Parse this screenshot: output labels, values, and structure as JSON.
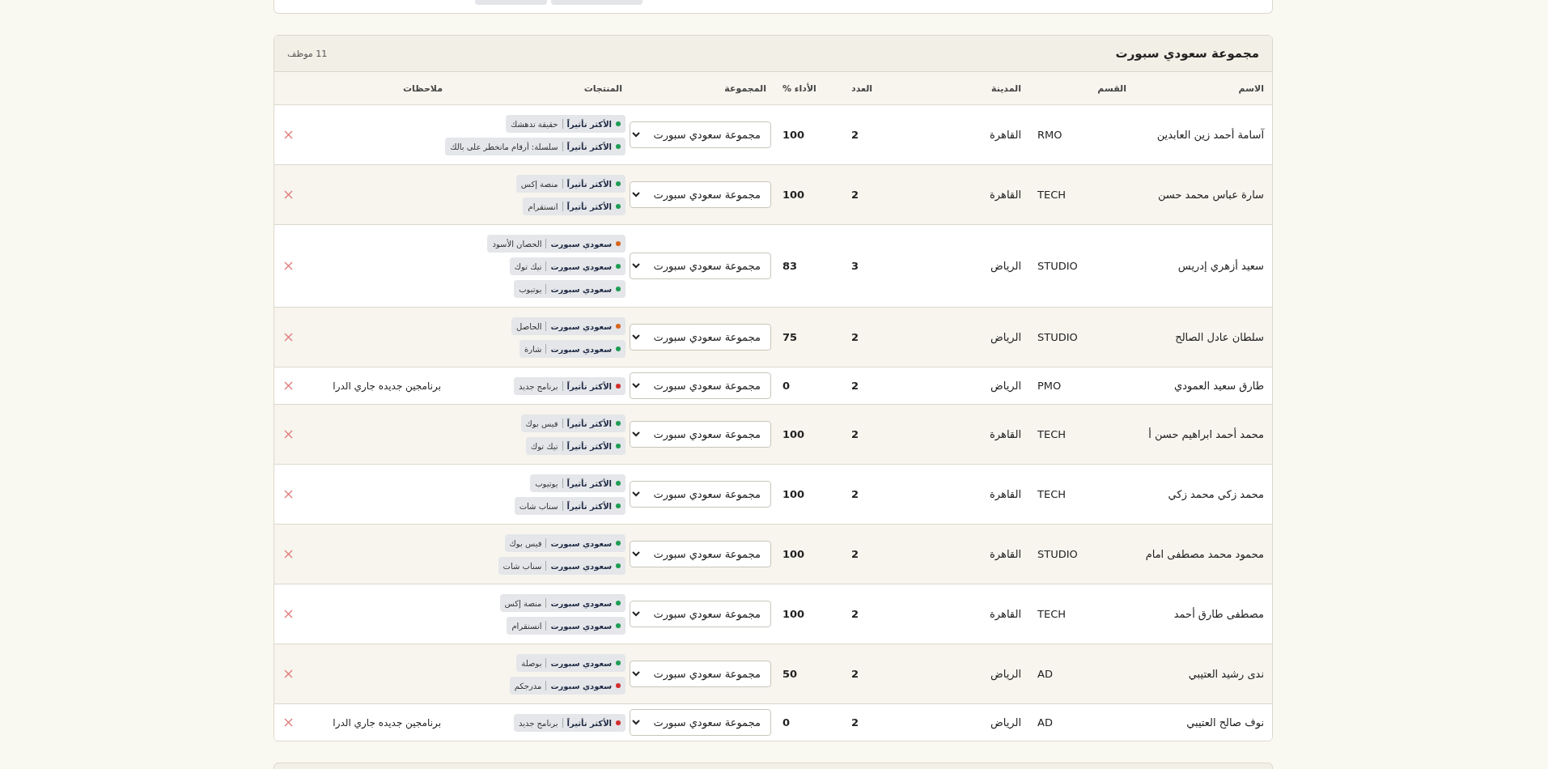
{
  "group": {
    "title": "مجموعة سعودي سبورت",
    "count": "11 موظف",
    "columns": [
      "الاسم",
      "القسم",
      "المدينة",
      "العدد",
      "الأداء %",
      "المجموعة",
      "المنتجات",
      "ملاحظات"
    ],
    "rows": [
      {
        "name": "آسامة أحمد زين العابدين",
        "department": "RMO",
        "city": "القاهرة",
        "count": "2",
        "performance": "100",
        "group": "مجموعة سعودي سبورت",
        "products": [
          {
            "label": "الأكثر تأثيراً",
            "name": "حقيقة تدهشك",
            "color": "#1f9d55"
          },
          {
            "label": "الأكثر تأثيراً",
            "name": "سلسلة: أرقام ماتخطر على بالك",
            "color": "#1f9d55"
          }
        ]
      },
      {
        "name": "سارة عباس محمد حسن",
        "department": "TECH",
        "city": "القاهرة",
        "count": "2",
        "performance": "100",
        "group": "مجموعة سعودي سبورت",
        "products": [
          {
            "label": "الأكثر تأثيراً",
            "name": "منصة إكس",
            "color": "#1f9d55"
          },
          {
            "label": "الأكثر تأثيراً",
            "name": "انستقرام",
            "color": "#1f9d55"
          }
        ]
      },
      {
        "name": "سعيد أزهري إدريس",
        "department": "STUDIO",
        "city": "الرياض",
        "count": "3",
        "performance": "83",
        "group": "مجموعة سعودي سبورت",
        "products": [
          {
            "label": "سعودي سبورت",
            "name": "الحصان الأسود",
            "color": "#d9661f"
          },
          {
            "label": "سعودي سبورت",
            "name": "تيك توك",
            "color": "#1f9d55"
          },
          {
            "label": "سعودي سبورت",
            "name": "يوتيوب",
            "color": "#1f9d55"
          }
        ]
      },
      {
        "name": "سلطان عادل الصالح",
        "department": "STUDIO",
        "city": "الرياض",
        "count": "2",
        "performance": "75",
        "group": "مجموعة سعودي سبورت",
        "products": [
          {
            "label": "سعودي سبورت",
            "name": "الحاصل",
            "color": "#d9661f"
          },
          {
            "label": "سعودي سبورت",
            "name": "شارة",
            "color": "#1f9d55"
          }
        ]
      },
      {
        "name": "طارق سعيد العمودي",
        "department": "PMO",
        "city": "الرياض",
        "count": "2",
        "performance": "0",
        "group": "مجموعة سعودي سبورت",
        "products": [
          {
            "label": "الأكثر تأثيراً",
            "name": "برنامج جديد",
            "color": "#d32f2f"
          }
        ],
        "notes": "برنامجين جديده جاري الدرا"
      },
      {
        "name": "محمد أحمد ابراهيم حسن أ",
        "department": "TECH",
        "city": "القاهرة",
        "count": "2",
        "performance": "100",
        "group": "مجموعة سعودي سبورت",
        "products": [
          {
            "label": "الأكثر تأثيراً",
            "name": "فيس بوك",
            "color": "#1f9d55"
          },
          {
            "label": "الأكثر تأثيراً",
            "name": "تيك توك",
            "color": "#1f9d55"
          }
        ]
      },
      {
        "name": "محمد زكي محمد زكي",
        "department": "TECH",
        "city": "القاهرة",
        "count": "2",
        "performance": "100",
        "group": "مجموعة سعودي سبورت",
        "products": [
          {
            "label": "الأكثر تأثيراً",
            "name": "يوتيوب",
            "color": "#1f9d55"
          },
          {
            "label": "الأكثر تأثيراً",
            "name": "سناب شات",
            "color": "#1f9d55"
          }
        ]
      },
      {
        "name": "محمود محمد مصطفى امام",
        "department": "STUDIO",
        "city": "القاهرة",
        "count": "2",
        "performance": "100",
        "group": "مجموعة سعودي سبورت",
        "products": [
          {
            "label": "سعودي سبورت",
            "name": "فيس بوك",
            "color": "#1f9d55"
          },
          {
            "label": "سعودي سبورت",
            "name": "سناب شات",
            "color": "#1f9d55"
          }
        ]
      },
      {
        "name": "مصطفى طارق أحمد",
        "department": "TECH",
        "city": "القاهرة",
        "count": "2",
        "performance": "100",
        "group": "مجموعة سعودي سبورت",
        "products": [
          {
            "label": "سعودي سبورت",
            "name": "منصة إكس",
            "color": "#1f9d55"
          },
          {
            "label": "سعودي سبورت",
            "name": "انستقرام",
            "color": "#1f9d55"
          }
        ]
      },
      {
        "name": "ندى رشيد العتيبي",
        "department": "AD",
        "city": "الرياض",
        "count": "2",
        "performance": "50",
        "group": "مجموعة سعودي سبورت",
        "products": [
          {
            "label": "سعودي سبورت",
            "name": "بوصلة",
            "color": "#1f9d55"
          },
          {
            "label": "سعودي سبورت",
            "name": "مدرجكم",
            "color": "#d32f2f"
          }
        ]
      },
      {
        "name": "نوف صالح العتيبي",
        "department": "AD",
        "city": "الرياض",
        "count": "2",
        "performance": "0",
        "group": "مجموعة سعودي سبورت",
        "products": [
          {
            "label": "الأكثر تأثيراً",
            "name": "برنامج جديد",
            "color": "#d32f2f"
          }
        ],
        "notes": "برنامجين جديده جاري الدرا"
      }
    ]
  }
}
